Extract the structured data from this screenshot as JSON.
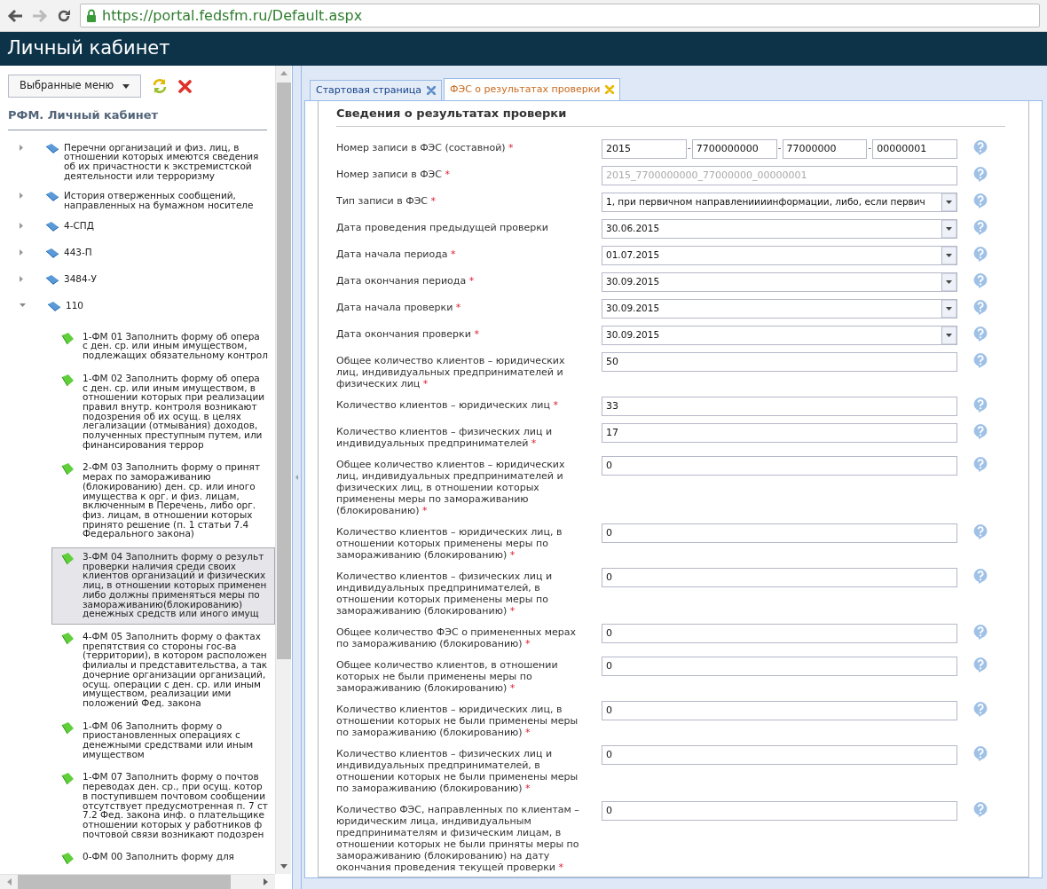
{
  "browser": {
    "url": "https://portal.fedsfm.ru/Default.aspx"
  },
  "header": {
    "title": "Личный кабинет"
  },
  "sidebar": {
    "favorites_button": "Выбранные меню",
    "title": "РФМ. Личный кабинет",
    "tree": [
      {
        "lines": [
          "Перечни организаций и физ. лиц, в",
          "отношении которых имеются сведения",
          "об их причастности к экстремистской",
          "деятельности или терроризму"
        ],
        "expanded": false
      },
      {
        "lines": [
          "История отверженных сообщений,",
          "направленных на бумажном носителе"
        ],
        "expanded": false
      },
      {
        "lines": [
          "4-СПД"
        ],
        "expanded": false
      },
      {
        "lines": [
          "443-П"
        ],
        "expanded": false
      },
      {
        "lines": [
          "3484-У"
        ],
        "expanded": false
      },
      {
        "lines": [
          "110"
        ],
        "expanded": true,
        "children": [
          {
            "lines": [
              "1-ФМ 01 Заполнить форму об опера",
              "с ден. ср. или иным имуществом,",
              "подлежащих обязательному контрол"
            ],
            "selected": false
          },
          {
            "lines": [
              "1-ФМ 02 Заполнить форму об опера",
              "с ден. ср. или иным имуществом, в",
              "отношении которых при реализации",
              "правил внутр. контроля возникают",
              "подозрения об их осущ. в целях",
              "легализации (отмывания) доходов,",
              "полученных преступным путем, или",
              "финансирования террор"
            ],
            "selected": false
          },
          {
            "lines": [
              "2-ФМ 03 Заполнить форму о принят",
              "мерах по замораживанию",
              "(блокированию) ден. ср. или иного",
              "имущества к орг. и физ. лицам,",
              "включенным в Перечень, либо орг.",
              "физ. лицам, в отношении которых",
              "принято решение (п. 1 статьи 7.4",
              "Федерального закона)"
            ],
            "selected": false
          },
          {
            "lines": [
              "3-ФМ 04 Заполнить форму о результ",
              "проверки наличия среди своих",
              "клиентов организаций и физических",
              "лиц, в отношении которых применен",
              "либо должны применяться меры по",
              "замораживанию(блокированию)",
              "денежных средств или иного имущ"
            ],
            "selected": true
          },
          {
            "lines": [
              "4-ФМ 05 Заполнить форму о фактах",
              "препятствия со стороны гос-ва",
              "(территории), в котором расположен",
              "филиалы и представительства, а так",
              "дочерние организации организаций,",
              "осущ. операции с ден. ср. или иным",
              "имуществом, реализации ими",
              "положений Фед. закона"
            ],
            "selected": false
          },
          {
            "lines": [
              "1-ФМ 06 Заполнить форму о",
              "приостановленных операциях с",
              "денежными средствами или иным",
              "имуществом"
            ],
            "selected": false
          },
          {
            "lines": [
              "1-ФМ 07 Заполнить форму о почтов",
              "переводах ден. ср., при осущ. котор",
              "в поступившем почтовом сообщении",
              "отсутствует предусмотренная п. 7 ст",
              "7.2 Фед. закона инф. о плательщике",
              "отношении которых у работников ф",
              "почтовой связи возникают подозрен"
            ],
            "selected": false
          },
          {
            "lines": [
              "0-ФМ 00 Заполнить форму для"
            ],
            "selected": false
          }
        ]
      }
    ]
  },
  "tabs": [
    {
      "label": "Стартовая страница",
      "selected": false
    },
    {
      "label": "ФЭС о результатах проверки",
      "selected": true
    }
  ],
  "form": {
    "title": "Сведения о результатах проверки",
    "required_mark": "*",
    "fields": [
      {
        "kind": "composite",
        "label": "Номер записи в ФЭС (составной)",
        "required": true,
        "parts": [
          "2015",
          "7700000000",
          "77000000",
          "00000001"
        ],
        "separator": "-"
      },
      {
        "kind": "text",
        "label": "Номер записи в ФЭС",
        "required": true,
        "value": "2015_7700000000_77000000_00000001",
        "disabled": true
      },
      {
        "kind": "select",
        "label": "Тип записи в ФЭС",
        "required": true,
        "value": "1, при первичном направлениииинформации, либо, если первич"
      },
      {
        "kind": "select",
        "label": "Дата проведения предыдущей проверки",
        "required": false,
        "value": "30.06.2015"
      },
      {
        "kind": "select",
        "label": "Дата начала периода",
        "required": true,
        "value": "01.07.2015"
      },
      {
        "kind": "select",
        "label": "Дата окончания периода",
        "required": true,
        "value": "30.09.2015"
      },
      {
        "kind": "select",
        "label": "Дата начала проверки",
        "required": true,
        "value": "30.09.2015"
      },
      {
        "kind": "select",
        "label": "Дата окончания проверки",
        "required": true,
        "value": "30.09.2015"
      },
      {
        "kind": "text",
        "label": "Общее количество клиентов – юридических лиц, индивидуальных предпринимателей и физических лиц",
        "required": true,
        "value": "50",
        "disabled": false
      },
      {
        "kind": "text",
        "label": "Количество клиентов – юридических лиц",
        "required": true,
        "value": "33",
        "disabled": false
      },
      {
        "kind": "text",
        "label": "Количество клиентов – физических лиц и индивидуальных предпринимателей",
        "required": true,
        "value": "17",
        "disabled": false
      },
      {
        "kind": "text",
        "label": "Общее количество клиентов – юридических лиц, индивидуальных предпринимателей и физических лиц, в отношении которых применены меры по замораживанию (блокированию)",
        "required": true,
        "value": "0",
        "disabled": false
      },
      {
        "kind": "text",
        "label": "Количество клиентов – юридических лиц, в отношении которых применены меры по замораживанию (блокированию)",
        "required": true,
        "value": "0",
        "disabled": false
      },
      {
        "kind": "text",
        "label": "Количество клиентов – физических лиц и индивидуальных предпринимателей, в отношении которых применены меры по замораживанию (блокированию)",
        "required": true,
        "value": "0",
        "disabled": false
      },
      {
        "kind": "text",
        "label": "Общее количество ФЭС о примененных мерах по замораживанию (блокированию)",
        "required": true,
        "value": "0",
        "disabled": false
      },
      {
        "kind": "text",
        "label": "Общее количество клиентов, в отношении которых не были применены меры по замораживанию (блокированию)",
        "required": true,
        "value": "0",
        "disabled": false
      },
      {
        "kind": "text",
        "label": "Количество клиентов – юридических лиц, в отношении которых не были применены меры по замораживанию (блокированию)",
        "required": true,
        "value": "0",
        "disabled": false
      },
      {
        "kind": "text",
        "label": "Количество клиентов – физических лиц и индивидуальных предпринимателей, в отношении которых не были применены меры по замораживанию (блокированию)",
        "required": true,
        "value": "0",
        "disabled": false
      },
      {
        "kind": "text",
        "label": "Количество ФЭС, направленных по клиентам – юридическим лица, индивидуальным предпринимателям и физическим лицам, в отношении которых не были приняты меры по замораживанию (блокированию) на дату окончания проведения текущей проверки",
        "required": true,
        "value": "0",
        "disabled": false
      }
    ]
  }
}
